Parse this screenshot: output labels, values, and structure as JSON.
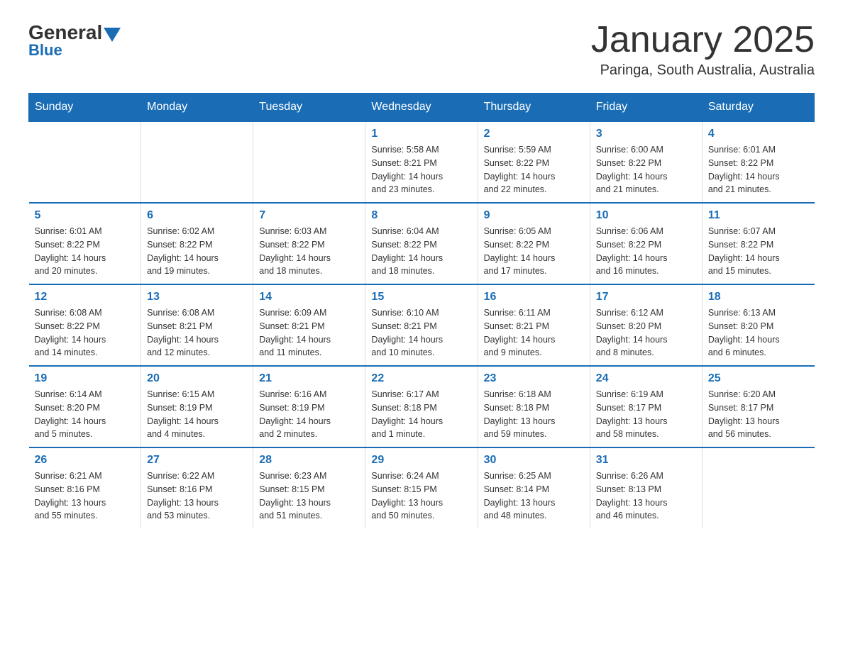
{
  "header": {
    "logo_general": "General",
    "logo_blue": "Blue",
    "month_title": "January 2025",
    "location": "Paringa, South Australia, Australia"
  },
  "days_of_week": [
    "Sunday",
    "Monday",
    "Tuesday",
    "Wednesday",
    "Thursday",
    "Friday",
    "Saturday"
  ],
  "weeks": [
    [
      {
        "day": "",
        "info": ""
      },
      {
        "day": "",
        "info": ""
      },
      {
        "day": "",
        "info": ""
      },
      {
        "day": "1",
        "info": "Sunrise: 5:58 AM\nSunset: 8:21 PM\nDaylight: 14 hours\nand 23 minutes."
      },
      {
        "day": "2",
        "info": "Sunrise: 5:59 AM\nSunset: 8:22 PM\nDaylight: 14 hours\nand 22 minutes."
      },
      {
        "day": "3",
        "info": "Sunrise: 6:00 AM\nSunset: 8:22 PM\nDaylight: 14 hours\nand 21 minutes."
      },
      {
        "day": "4",
        "info": "Sunrise: 6:01 AM\nSunset: 8:22 PM\nDaylight: 14 hours\nand 21 minutes."
      }
    ],
    [
      {
        "day": "5",
        "info": "Sunrise: 6:01 AM\nSunset: 8:22 PM\nDaylight: 14 hours\nand 20 minutes."
      },
      {
        "day": "6",
        "info": "Sunrise: 6:02 AM\nSunset: 8:22 PM\nDaylight: 14 hours\nand 19 minutes."
      },
      {
        "day": "7",
        "info": "Sunrise: 6:03 AM\nSunset: 8:22 PM\nDaylight: 14 hours\nand 18 minutes."
      },
      {
        "day": "8",
        "info": "Sunrise: 6:04 AM\nSunset: 8:22 PM\nDaylight: 14 hours\nand 18 minutes."
      },
      {
        "day": "9",
        "info": "Sunrise: 6:05 AM\nSunset: 8:22 PM\nDaylight: 14 hours\nand 17 minutes."
      },
      {
        "day": "10",
        "info": "Sunrise: 6:06 AM\nSunset: 8:22 PM\nDaylight: 14 hours\nand 16 minutes."
      },
      {
        "day": "11",
        "info": "Sunrise: 6:07 AM\nSunset: 8:22 PM\nDaylight: 14 hours\nand 15 minutes."
      }
    ],
    [
      {
        "day": "12",
        "info": "Sunrise: 6:08 AM\nSunset: 8:22 PM\nDaylight: 14 hours\nand 14 minutes."
      },
      {
        "day": "13",
        "info": "Sunrise: 6:08 AM\nSunset: 8:21 PM\nDaylight: 14 hours\nand 12 minutes."
      },
      {
        "day": "14",
        "info": "Sunrise: 6:09 AM\nSunset: 8:21 PM\nDaylight: 14 hours\nand 11 minutes."
      },
      {
        "day": "15",
        "info": "Sunrise: 6:10 AM\nSunset: 8:21 PM\nDaylight: 14 hours\nand 10 minutes."
      },
      {
        "day": "16",
        "info": "Sunrise: 6:11 AM\nSunset: 8:21 PM\nDaylight: 14 hours\nand 9 minutes."
      },
      {
        "day": "17",
        "info": "Sunrise: 6:12 AM\nSunset: 8:20 PM\nDaylight: 14 hours\nand 8 minutes."
      },
      {
        "day": "18",
        "info": "Sunrise: 6:13 AM\nSunset: 8:20 PM\nDaylight: 14 hours\nand 6 minutes."
      }
    ],
    [
      {
        "day": "19",
        "info": "Sunrise: 6:14 AM\nSunset: 8:20 PM\nDaylight: 14 hours\nand 5 minutes."
      },
      {
        "day": "20",
        "info": "Sunrise: 6:15 AM\nSunset: 8:19 PM\nDaylight: 14 hours\nand 4 minutes."
      },
      {
        "day": "21",
        "info": "Sunrise: 6:16 AM\nSunset: 8:19 PM\nDaylight: 14 hours\nand 2 minutes."
      },
      {
        "day": "22",
        "info": "Sunrise: 6:17 AM\nSunset: 8:18 PM\nDaylight: 14 hours\nand 1 minute."
      },
      {
        "day": "23",
        "info": "Sunrise: 6:18 AM\nSunset: 8:18 PM\nDaylight: 13 hours\nand 59 minutes."
      },
      {
        "day": "24",
        "info": "Sunrise: 6:19 AM\nSunset: 8:17 PM\nDaylight: 13 hours\nand 58 minutes."
      },
      {
        "day": "25",
        "info": "Sunrise: 6:20 AM\nSunset: 8:17 PM\nDaylight: 13 hours\nand 56 minutes."
      }
    ],
    [
      {
        "day": "26",
        "info": "Sunrise: 6:21 AM\nSunset: 8:16 PM\nDaylight: 13 hours\nand 55 minutes."
      },
      {
        "day": "27",
        "info": "Sunrise: 6:22 AM\nSunset: 8:16 PM\nDaylight: 13 hours\nand 53 minutes."
      },
      {
        "day": "28",
        "info": "Sunrise: 6:23 AM\nSunset: 8:15 PM\nDaylight: 13 hours\nand 51 minutes."
      },
      {
        "day": "29",
        "info": "Sunrise: 6:24 AM\nSunset: 8:15 PM\nDaylight: 13 hours\nand 50 minutes."
      },
      {
        "day": "30",
        "info": "Sunrise: 6:25 AM\nSunset: 8:14 PM\nDaylight: 13 hours\nand 48 minutes."
      },
      {
        "day": "31",
        "info": "Sunrise: 6:26 AM\nSunset: 8:13 PM\nDaylight: 13 hours\nand 46 minutes."
      },
      {
        "day": "",
        "info": ""
      }
    ]
  ]
}
